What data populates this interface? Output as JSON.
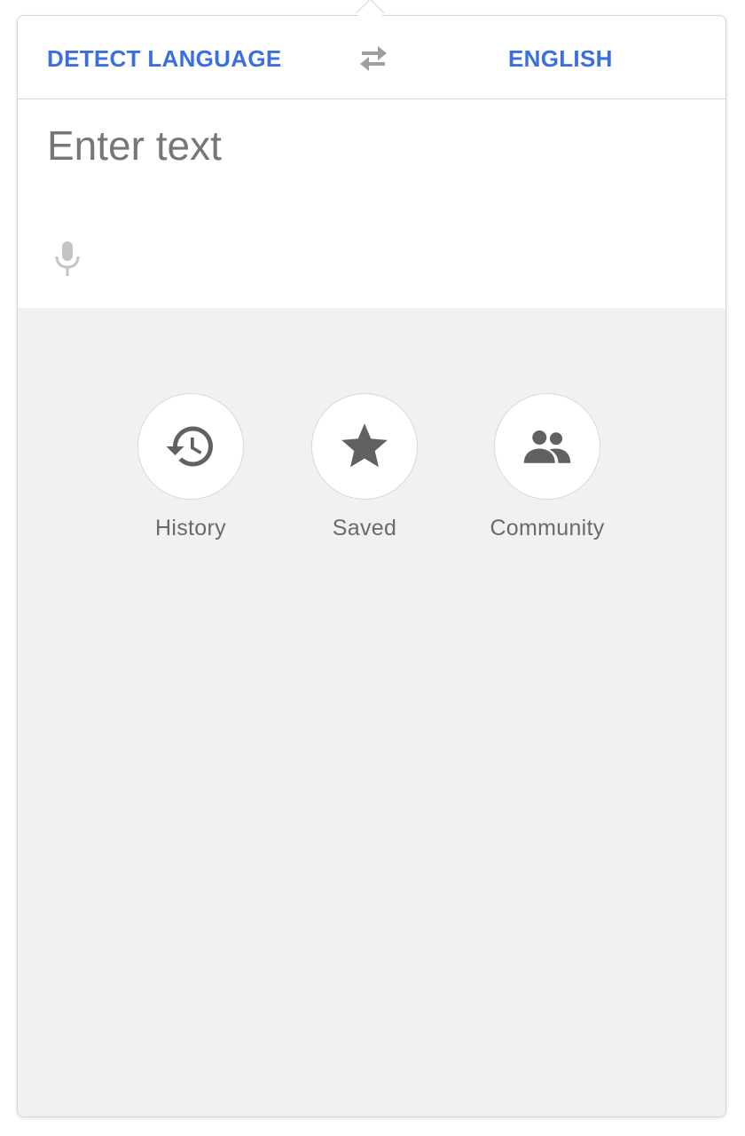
{
  "header": {
    "source_language": "DETECT LANGUAGE",
    "target_language": "ENGLISH",
    "swap_icon": "swap-arrows-icon"
  },
  "input": {
    "placeholder": "Enter text",
    "value": "",
    "mic_icon": "microphone-icon"
  },
  "actions": [
    {
      "label": "History",
      "icon": "history-icon"
    },
    {
      "label": "Saved",
      "icon": "star-icon"
    },
    {
      "label": "Community",
      "icon": "people-icon"
    }
  ],
  "colors": {
    "accent": "#3a6fe0",
    "icon": "#616161",
    "muted_icon": "#c4c4c4",
    "panel_background": "#f1f1f1",
    "label": "#6a6a6a"
  }
}
